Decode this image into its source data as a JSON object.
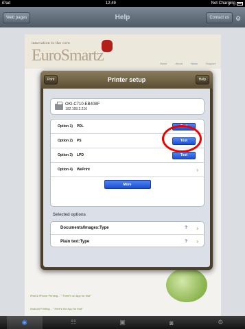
{
  "status": {
    "device": "iPad",
    "time": "12:49",
    "charging": "Not Charging"
  },
  "nav": {
    "title": "Help",
    "left_button": "Web pages",
    "right_button": "Contact us"
  },
  "site": {
    "tagline": "innovation to the core",
    "logo": "EuroSmartz",
    "nav_items": [
      "Home",
      "About",
      "News",
      "Support"
    ],
    "bottom_links": [
      "iPad & iPhone Printing... \" There's an App for that\"",
      "Android Printing... \" Here's the App for that\""
    ]
  },
  "modal": {
    "title": "Printer setup",
    "print_button": "Print",
    "help_button": "Help",
    "printer_name": "OKI-C710-EB408F",
    "printer_ip": "192.168.2.216",
    "options": [
      {
        "label": "Option 1)",
        "name": "PDL",
        "button": "Test"
      },
      {
        "label": "Option 2)",
        "name": "PS",
        "button": "Test"
      },
      {
        "label": "Option 3)",
        "name": "LPD",
        "button": "Test"
      },
      {
        "label": "Option 4)",
        "name": "WePrint",
        "button": ""
      }
    ],
    "more_button": "More",
    "selected_label": "Selected options",
    "selected_items": [
      {
        "text": "Documents/Images:Type",
        "q": "?"
      },
      {
        "text": "Plain text:Type",
        "q": "?"
      }
    ]
  },
  "tabs": [
    "globe-icon",
    "people-icon",
    "image-icon",
    "camera-icon",
    "gear-icon"
  ]
}
